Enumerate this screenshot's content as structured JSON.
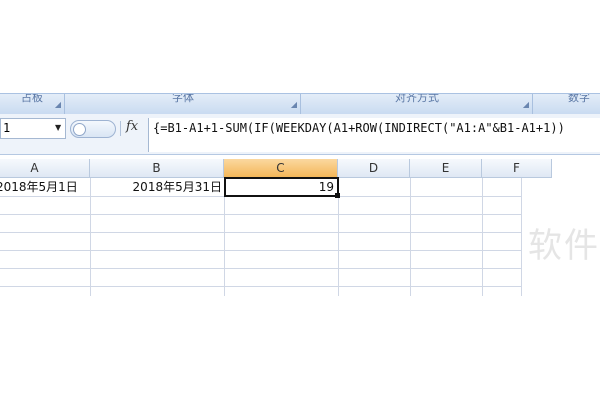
{
  "ribbon": {
    "groups": [
      {
        "label": "占板"
      },
      {
        "label": "字体"
      },
      {
        "label": "对齐方式"
      },
      {
        "label": "数字"
      }
    ]
  },
  "formula_bar": {
    "name_box": "1",
    "fx_label": "fx",
    "formula": "{=B1-A1+1-SUM(IF(WEEKDAY(A1+ROW(INDIRECT(\"A1:A\"&B1-A1+1))"
  },
  "columns": [
    "A",
    "B",
    "C",
    "D",
    "E",
    "F"
  ],
  "active_column": "C",
  "cells": {
    "A1": "2018年5月1日",
    "B1": "2018年5月31日",
    "C1": "19"
  },
  "watermark": "软件"
}
